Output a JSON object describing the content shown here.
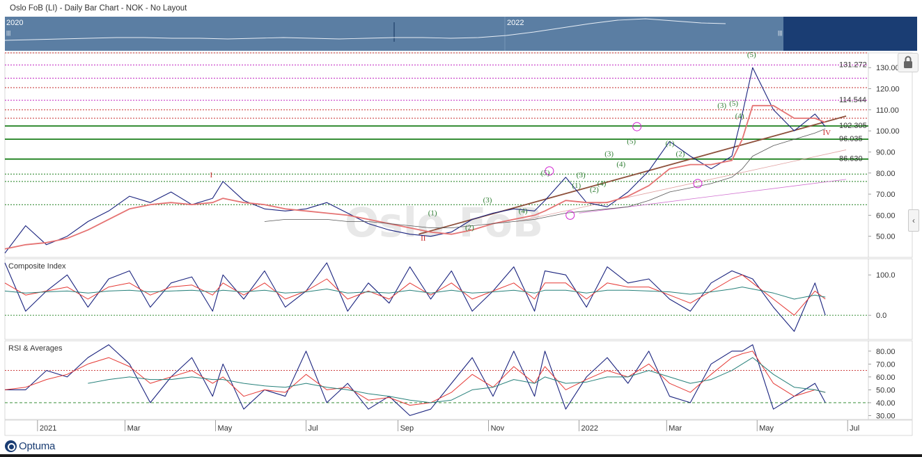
{
  "header": {
    "title": "Oslo FoB (LI) - Daily Bar Chart - NOK - No Layout"
  },
  "navigator": {
    "year_labels": [
      "2020",
      "2022"
    ],
    "handle_glyph": "|||"
  },
  "watermark": "Oslo FoB",
  "logo": {
    "text": "Optuma",
    "icon": "optuma-logo-icon"
  },
  "controls": {
    "lock_icon": "lock-icon",
    "collapse_icon": "chevron-left-icon",
    "collapse_glyph": "‹"
  },
  "colors": {
    "navigator_bg": "#5b7ea3",
    "navigator_dark": "#1a3d73",
    "price": "#1a237e",
    "ma_red": "#e57373",
    "ma_brown": "#8d4f3a",
    "composite_red": "#e53935",
    "composite_teal": "#26807a",
    "level_green": "#1b7f1b",
    "level_magenta": "#c020c0",
    "level_red": "#c62828"
  },
  "chart_data": [
    {
      "type": "line",
      "panel": "price",
      "x": [
        "2020-12-10",
        "2020-12-24",
        "2021-01-07",
        "2021-01-21",
        "2021-02-04",
        "2021-02-18",
        "2021-03-04",
        "2021-03-18",
        "2021-04-01",
        "2021-04-15",
        "2021-04-29",
        "2021-05-06",
        "2021-05-20",
        "2021-06-03",
        "2021-06-17",
        "2021-07-01",
        "2021-07-15",
        "2021-07-29",
        "2021-08-12",
        "2021-08-26",
        "2021-09-09",
        "2021-09-23",
        "2021-10-07",
        "2021-10-21",
        "2021-11-04",
        "2021-11-18",
        "2021-12-02",
        "2021-12-09",
        "2021-12-23",
        "2022-01-06",
        "2022-01-20",
        "2022-02-03",
        "2022-02-17",
        "2022-03-03",
        "2022-03-17",
        "2022-03-31",
        "2022-04-14",
        "2022-04-21",
        "2022-04-28",
        "2022-05-12",
        "2022-05-26",
        "2022-06-09",
        "2022-06-16"
      ],
      "series": [
        {
          "values": [
            42,
            55,
            46,
            50,
            57,
            62,
            69,
            66,
            71,
            65,
            68,
            76,
            67,
            63,
            62,
            63,
            66,
            61,
            56,
            53,
            51,
            50,
            52,
            58,
            61,
            63,
            62,
            67,
            78,
            66,
            64,
            71,
            81,
            95,
            88,
            82,
            88,
            108,
            130,
            110,
            100,
            108,
            102
          ]
        },
        {
          "values": [
            44,
            46,
            47,
            49,
            53,
            58,
            63,
            65,
            66,
            65,
            66,
            68,
            66,
            65,
            63,
            62,
            61,
            60,
            58,
            56,
            54,
            52,
            51,
            53,
            56,
            58,
            60,
            62,
            67,
            66,
            66,
            69,
            74,
            82,
            84,
            84,
            86,
            96,
            112,
            112,
            106,
            106,
            104
          ]
        },
        {
          "values": [
            null,
            null,
            null,
            null,
            null,
            null,
            null,
            null,
            null,
            null,
            null,
            null,
            null,
            57,
            58,
            58,
            58,
            57,
            57,
            56,
            55,
            54,
            54,
            55,
            56,
            57,
            58,
            59,
            61,
            62,
            63,
            64,
            67,
            71,
            73,
            75,
            78,
            82,
            88,
            93,
            96,
            99,
            101
          ]
        }
      ],
      "ylim": [
        40,
        137
      ],
      "y_ticks": [
        "130.00",
        "120.00",
        "110.00",
        "100.00",
        "90.00",
        "80.00",
        "70.00",
        "60.00",
        "50.00"
      ],
      "levels": [
        {
          "label": "131.272",
          "value": 131.272
        },
        {
          "label": "114.544",
          "value": 114.544
        },
        {
          "label": "102.305",
          "value": 102.305
        },
        {
          "label": "96.035",
          "value": 96.035
        },
        {
          "label": "86.630",
          "value": 86.63
        }
      ],
      "wave_labels": [
        "I",
        "II",
        "IV",
        "(1)",
        "(2)",
        "(3)",
        "(4)",
        "(5)",
        "(3)",
        "(4)",
        "(5)",
        "(1)",
        "(2)",
        "(3)",
        "(4)",
        "(5)",
        "(1)",
        "(2)",
        "(3)",
        "(4)",
        "(5)"
      ]
    },
    {
      "type": "line",
      "panel": "composite",
      "title": "Composite Index",
      "y_ticks": [
        "100.0",
        "0.0"
      ],
      "ylim": [
        -60,
        140
      ],
      "series": [
        {
          "values": [
            130,
            10,
            60,
            100,
            20,
            90,
            110,
            20,
            80,
            95,
            10,
            100,
            40,
            110,
            20,
            60,
            130,
            10,
            80,
            30,
            120,
            40,
            110,
            10,
            60,
            120,
            10,
            110,
            100,
            20,
            120,
            80,
            90,
            40,
            10,
            80,
            110,
            100,
            90,
            20,
            -40,
            80,
            0
          ]
        },
        {
          "values": [
            80,
            50,
            60,
            70,
            40,
            70,
            80,
            50,
            70,
            75,
            50,
            80,
            50,
            80,
            40,
            60,
            90,
            40,
            60,
            40,
            80,
            50,
            80,
            40,
            60,
            80,
            40,
            80,
            80,
            40,
            80,
            70,
            70,
            50,
            30,
            60,
            90,
            100,
            80,
            40,
            0,
            60,
            40
          ]
        },
        {
          "values": [
            60,
            55,
            58,
            60,
            55,
            60,
            62,
            58,
            60,
            62,
            58,
            62,
            58,
            62,
            55,
            58,
            65,
            55,
            58,
            55,
            62,
            55,
            62,
            55,
            58,
            62,
            55,
            62,
            62,
            55,
            62,
            62,
            60,
            58,
            52,
            58,
            65,
            70,
            65,
            55,
            40,
            50,
            45
          ]
        }
      ]
    },
    {
      "type": "line",
      "panel": "rsi",
      "title": "RSI & Averages",
      "y_ticks": [
        "80.00",
        "70.00",
        "60.00",
        "50.00",
        "40.00",
        "30.00"
      ],
      "ylim": [
        27,
        88
      ],
      "levels": [
        65,
        40
      ],
      "series": [
        {
          "values": [
            50,
            50,
            65,
            60,
            75,
            85,
            70,
            40,
            60,
            75,
            45,
            70,
            35,
            50,
            45,
            80,
            40,
            55,
            35,
            45,
            30,
            35,
            55,
            75,
            45,
            80,
            45,
            80,
            35,
            60,
            75,
            55,
            80,
            45,
            40,
            70,
            80,
            80,
            85,
            35,
            45,
            55,
            40
          ]
        },
        {
          "values": [
            50,
            52,
            58,
            62,
            70,
            75,
            68,
            55,
            60,
            65,
            55,
            60,
            45,
            50,
            48,
            62,
            50,
            52,
            42,
            44,
            38,
            40,
            48,
            62,
            52,
            68,
            55,
            68,
            50,
            58,
            65,
            60,
            70,
            55,
            48,
            62,
            75,
            78,
            80,
            55,
            45,
            50,
            48
          ]
        },
        {
          "values": [
            null,
            null,
            null,
            null,
            55,
            58,
            60,
            58,
            58,
            60,
            58,
            58,
            55,
            53,
            52,
            55,
            52,
            50,
            47,
            45,
            42,
            40,
            42,
            50,
            52,
            58,
            55,
            60,
            55,
            56,
            60,
            60,
            65,
            60,
            55,
            58,
            65,
            70,
            75,
            62,
            52,
            50,
            48
          ]
        }
      ]
    }
  ],
  "x_axis": {
    "labels": [
      "2021",
      "Mar",
      "May",
      "Jul",
      "Sep",
      "Nov",
      "2022",
      "Mar",
      "May",
      "Jul"
    ]
  }
}
